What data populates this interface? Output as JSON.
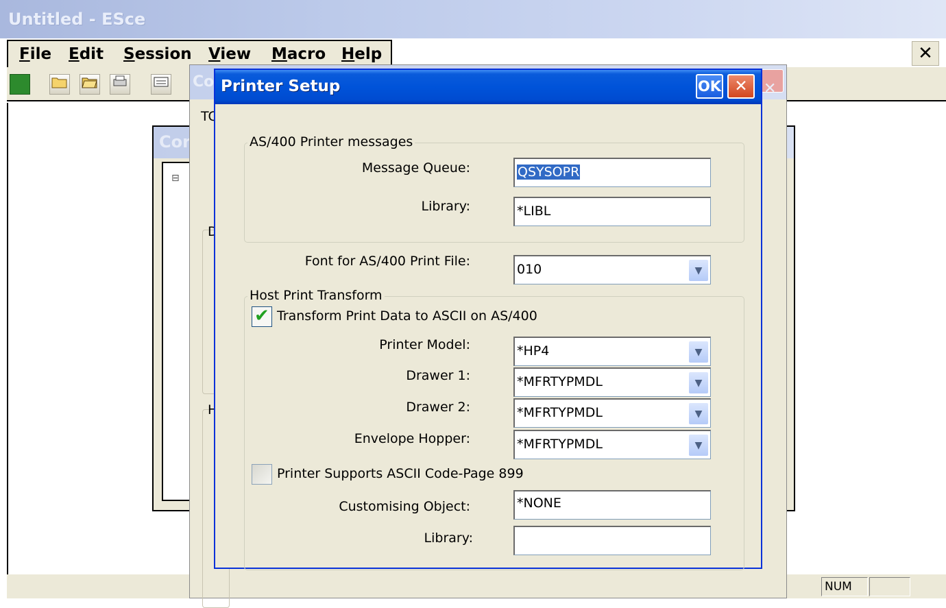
{
  "app": {
    "title": "Untitled - ESce",
    "close_glyph": "✕",
    "menu": [
      "File",
      "Edit",
      "Session",
      "View",
      "Macro",
      "Help"
    ]
  },
  "toolbar": {
    "icons": [
      "connect-icon",
      "open-folder-icon",
      "open-folder-alt-icon",
      "print-icon",
      "keyboard-icon"
    ]
  },
  "background_windows": {
    "win1_title_fragment": "Cor",
    "win1_tree_glyph": "⊟",
    "win2_title_fragment": "Co",
    "win2_fragments": [
      "TC",
      "D",
      "H"
    ]
  },
  "dialog": {
    "title": "Printer Setup",
    "ok_label": "OK",
    "close_glyph": "✕",
    "messages_group": {
      "label": "AS/400 Printer messages",
      "message_queue_label": "Message Queue:",
      "message_queue_value": "QSYSOPR",
      "library_label": "Library:",
      "library_value": "*LIBL"
    },
    "font_label": "Font for AS/400 Print File:",
    "font_value": "010",
    "hpt_group": {
      "label": "Host Print Transform",
      "transform_checkbox_label": "Transform Print Data to ASCII on AS/400",
      "transform_checked": true,
      "printer_model_label": "Printer Model:",
      "printer_model_value": "*HP4",
      "drawer1_label": "Drawer 1:",
      "drawer1_value": "*MFRTYPMDL",
      "drawer2_label": "Drawer 2:",
      "drawer2_value": "*MFRTYPMDL",
      "envelope_label": "Envelope Hopper:",
      "envelope_value": "*MFRTYPMDL",
      "ascii899_checkbox_label": "Printer Supports ASCII Code-Page 899",
      "ascii899_checked": false,
      "customising_label": "Customising Object:",
      "customising_value": "*NONE",
      "cust_library_label": "Library:",
      "cust_library_value": ""
    }
  },
  "statusbar": {
    "num_label": "NUM"
  },
  "colors": {
    "xp_title_blue": "#0053d9",
    "dialog_face": "#ece9d8",
    "selection": "#316ac5",
    "checkmark": "#21a121"
  }
}
